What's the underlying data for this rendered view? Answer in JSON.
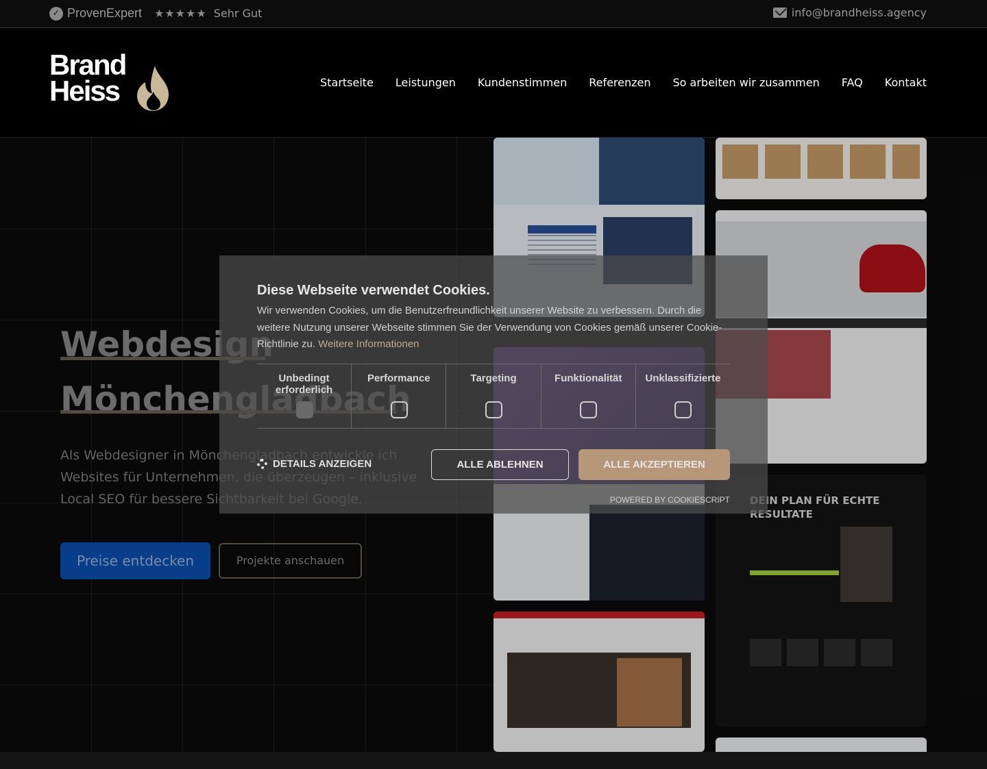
{
  "topbar": {
    "proven_expert": "ProvenExpert",
    "stars": "★★★★★",
    "rating": "Sehr Gut",
    "email": "info@brandheiss.agency"
  },
  "logo": {
    "line1": "Brand",
    "line2": "Heiss"
  },
  "nav": {
    "items": [
      "Startseite",
      "Leistungen",
      "Kundenstimmen",
      "Referenzen",
      "So arbeiten wir zusammen",
      "FAQ",
      "Kontakt"
    ]
  },
  "hero": {
    "title_line1": "Webdesign",
    "title_line2": "Mönchengladbach",
    "subtitle": "Als Webdesigner in Mönchengladbach entwickle ich Websites für Unternehmen, die überzeugen – inklusive Local SEO für bessere Sichtbarkeit bei Google.",
    "primary_button": "Preise entdecken",
    "secondary_button": "Projekte anschauen"
  },
  "portfolio": {
    "s6_heading": "DEIN PLAN FÜR ECHTE RESULTATE"
  },
  "cookie": {
    "title": "Diese Webseite verwendet Cookies. ",
    "text": "Wir verwenden Cookies, um die Benutzerfreundlichkeit unserer Website zu verbessern. Durch die weitere Nutzung unserer Webseite stimmen Sie der Verwendung von Cookies gemäß unserer Cookie-Richtlinie zu.",
    "link": "Weitere Informationen",
    "categories": [
      {
        "label": "Unbedingt erforderlich",
        "checked": true
      },
      {
        "label": "Performance",
        "checked": false
      },
      {
        "label": "Targeting",
        "checked": false
      },
      {
        "label": "Funktionalität",
        "checked": false
      },
      {
        "label": "Unklassifizierte",
        "checked": false
      }
    ],
    "details_label": "DETAILS ANZEIGEN",
    "reject_label": "ALLE ABLEHNEN",
    "accept_label": "ALLE AKZEPTIEREN",
    "powered": "POWERED BY COOKIESCRIPT"
  },
  "colors": {
    "accent_gold": "#b6977a",
    "primary_blue": "#0b4fb0"
  }
}
